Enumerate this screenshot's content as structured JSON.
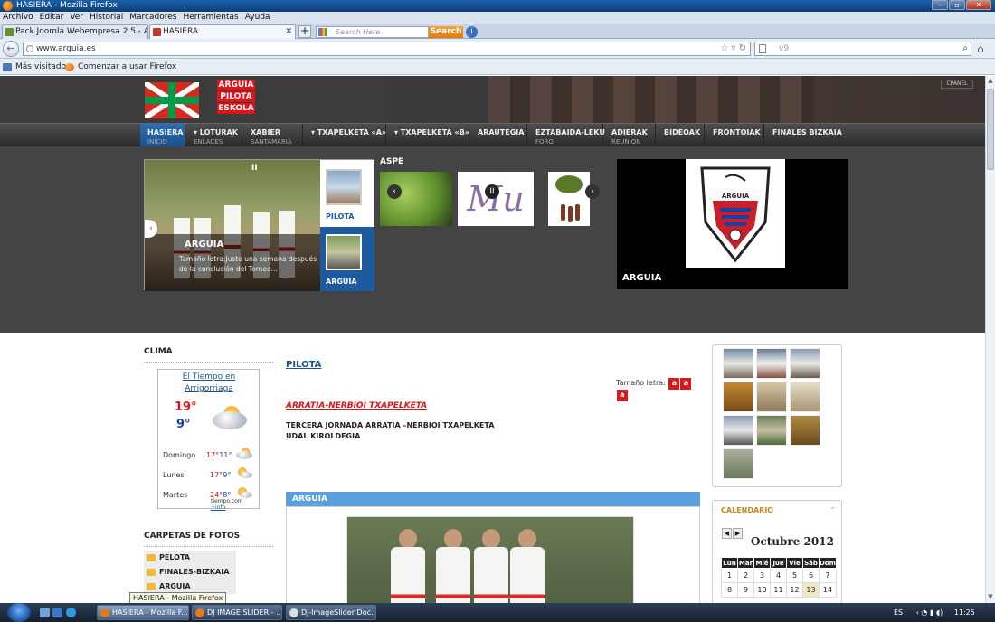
{
  "window": {
    "title": "HASIERA - Mozilla Firefox"
  },
  "menubar": [
    "Archivo",
    "Editar",
    "Ver",
    "Historial",
    "Marcadores",
    "Herramientas",
    "Ayuda"
  ],
  "tabs": [
    {
      "label": "Pack Joomla Webempresa 2.5 - Admi..."
    },
    {
      "label": "HASIERA"
    }
  ],
  "toolbar_search": {
    "placeholder": "Search Here",
    "button": "Search"
  },
  "urlbar": {
    "url": "www.arguia.es",
    "search_value": "v9"
  },
  "bookmarks": [
    "Más visitados",
    "Comenzar a usar Firefox"
  ],
  "site": {
    "logo_lines": [
      "ARGUIA",
      "PILOTA",
      "ESKOLA"
    ],
    "cpanel": "CPANEL",
    "menu": [
      {
        "label": "HASIERA",
        "sub": "INICIO"
      },
      {
        "label": "▾ LOTURAK",
        "sub": "ENLACES"
      },
      {
        "label": "XABIER",
        "sub": "SANTAMARIA"
      },
      {
        "label": "▾ TXAPELKETA «A»",
        "sub": ""
      },
      {
        "label": "▾ TXAPELKETA «B»",
        "sub": ""
      },
      {
        "label": "ARAUTEGIA",
        "sub": ""
      },
      {
        "label": "EZTABAIDA-LEKU",
        "sub": "FORO"
      },
      {
        "label": "ADIERAK",
        "sub": "REUNION"
      },
      {
        "label": "BIDEOAK",
        "sub": ""
      },
      {
        "label": "FRONTOIAK",
        "sub": ""
      },
      {
        "label": "FINALES BIZKAIA",
        "sub": ""
      }
    ],
    "slider1": {
      "title": "ARGUIA",
      "desc": "Tamaño letra:Justo una semana después de la conclusión del Torneo...",
      "thumb1": "PILOTA",
      "thumb2": "ARGUIA"
    },
    "slider2": {
      "label": "ASPE",
      "script_text": "Mu"
    },
    "slider3": {
      "title": "ARGUIA",
      "badge": "ARGUIA"
    },
    "clima": {
      "title": "CLIMA",
      "widget_title": "El Tiempo en Arrigorriaga",
      "temp_high": "19°",
      "temp_low": "9°",
      "days": [
        {
          "name": "Domingo",
          "hi": "17°",
          "lo": "11°"
        },
        {
          "name": "Lunes",
          "hi": "17°",
          "lo": "9°"
        },
        {
          "name": "Martes",
          "hi": "24°",
          "lo": "8°"
        }
      ],
      "source": "tiempo.com",
      "info": "+info"
    },
    "carpetas": {
      "title": "CARPETAS DE FOTOS",
      "items": [
        "PELOTA",
        "FINALES-BIZKAIA",
        "ARGUIA"
      ]
    },
    "center": {
      "link": "PILOTA",
      "fontsize_label": "Tamaño letra:",
      "fontsize_buttons": [
        "a",
        "a",
        "a"
      ],
      "article_title": "ARRATIA-NERBIOI TXAPELKETA",
      "p1": "TERCERA JORNADA ARRATIA –NERBIOI TXAPELKETA",
      "p2": "UDAL KIROLDEGIA",
      "box_title": "ARGUIA"
    },
    "calendar": {
      "title": "CALENDARIO",
      "month": "Octubre 2012",
      "headers": [
        "Lun",
        "Mar",
        "Mié",
        "Jue",
        "Vie",
        "Sáb",
        "Dom"
      ],
      "row1": [
        "1",
        "2",
        "3",
        "4",
        "5",
        "6",
        "7"
      ],
      "row2": [
        "8",
        "9",
        "10",
        "11",
        "12",
        "13",
        "14"
      ]
    }
  },
  "taskbar": {
    "items": [
      "HASIERA - Mozilla F...",
      "DJ IMAGE SLIDER - ...",
      "DJ-ImageSlider Doc..."
    ],
    "tooltip": "HASIERA - Mozilla Firefox",
    "lang": "ES",
    "clock": "11:25"
  },
  "colors": {
    "accent_red": "#e0131b",
    "menu_active": "#2a6fb5",
    "link_blue": "#1d4f91",
    "box_bar": "#5aa0dc",
    "calendar_title": "#c58a16"
  }
}
